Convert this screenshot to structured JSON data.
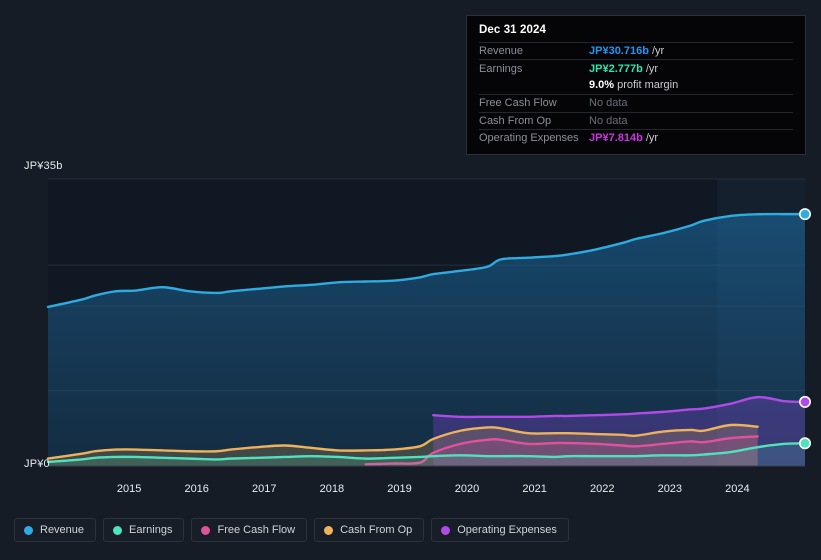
{
  "axes": {
    "y_top_label": "JP¥35b",
    "y_zero_label": "JP¥0",
    "x_ticks": [
      "2015",
      "2016",
      "2017",
      "2018",
      "2019",
      "2020",
      "2021",
      "2022",
      "2023",
      "2024"
    ]
  },
  "tooltip": {
    "date": "Dec 31 2024",
    "rows": [
      {
        "label": "Revenue",
        "value": "JP¥30.716b",
        "suffix": "/yr",
        "color": "#2196f3",
        "muted": false
      },
      {
        "label": "Earnings",
        "value": "JP¥2.777b",
        "suffix": "/yr",
        "color": "#2ee6b0",
        "muted": false
      },
      {
        "label": "",
        "value": "9.0%",
        "suffix": "profit margin",
        "color": "#ffffff",
        "muted": false
      },
      {
        "label": "Free Cash Flow",
        "value": "No data",
        "suffix": "",
        "color": "#6b6f77",
        "muted": true
      },
      {
        "label": "Cash From Op",
        "value": "No data",
        "suffix": "",
        "color": "#6b6f77",
        "muted": true
      },
      {
        "label": "Operating Expenses",
        "value": "JP¥7.814b",
        "suffix": "/yr",
        "color": "#c936e0",
        "muted": false
      }
    ]
  },
  "legend": [
    {
      "label": "Revenue",
      "color": "#2eabe0"
    },
    {
      "label": "Earnings",
      "color": "#4fe3bd"
    },
    {
      "label": "Free Cash Flow",
      "color": "#e0529c"
    },
    {
      "label": "Cash From Op",
      "color": "#eeb25a"
    },
    {
      "label": "Operating Expenses",
      "color": "#b04ae8"
    }
  ],
  "chart_data": {
    "type": "area",
    "title": "",
    "xlabel": "",
    "ylabel": "JP¥ (billions)",
    "ylim": [
      0,
      35
    ],
    "xlim": [
      2014.3,
      2025.5
    ],
    "grid": true,
    "currency": "JP¥",
    "units": "billions per year",
    "gridlines_y": [
      0,
      9.2,
      19.5,
      24.5,
      35
    ],
    "legend_position": "bottom-left",
    "forecast_region_start_x": 2024.2,
    "x": [
      2014.3,
      2014.8,
      2015.0,
      2015.3,
      2015.6,
      2016.0,
      2016.4,
      2016.8,
      2017.0,
      2017.4,
      2017.8,
      2018.2,
      2018.6,
      2019.0,
      2019.4,
      2019.8,
      2020.0,
      2020.4,
      2020.8,
      2021.0,
      2021.4,
      2021.8,
      2022.0,
      2022.4,
      2022.8,
      2023.0,
      2023.4,
      2023.8,
      2024.0,
      2024.4,
      2024.8,
      2025.2,
      2025.5
    ],
    "series": [
      {
        "name": "Revenue",
        "color": "#2eabe0",
        "fill": "rgba(33,122,184,0.30)",
        "end_value": 30.716,
        "end_label": "JP¥30.716b /yr",
        "values": [
          19.4,
          20.3,
          20.8,
          21.3,
          21.4,
          21.8,
          21.3,
          21.1,
          21.3,
          21.6,
          21.9,
          22.1,
          22.4,
          22.5,
          22.6,
          23.0,
          23.4,
          23.8,
          24.3,
          25.2,
          25.4,
          25.6,
          25.8,
          26.4,
          27.2,
          27.7,
          28.4,
          29.3,
          29.9,
          30.5,
          30.7,
          30.716,
          30.716
        ]
      },
      {
        "name": "Earnings",
        "color": "#4fe3bd",
        "fill": "rgba(79,227,189,0.16)",
        "end_value": 2.777,
        "end_label": "JP¥2.777b /yr",
        "values": [
          0.5,
          0.8,
          1.0,
          1.1,
          1.1,
          1.0,
          0.9,
          0.8,
          0.9,
          1.0,
          1.1,
          1.2,
          1.1,
          0.9,
          1.0,
          1.1,
          1.2,
          1.3,
          1.2,
          1.2,
          1.2,
          1.1,
          1.2,
          1.2,
          1.2,
          1.2,
          1.3,
          1.3,
          1.4,
          1.7,
          2.3,
          2.7,
          2.777
        ]
      },
      {
        "name": "Free Cash Flow",
        "color": "#e0529c",
        "fill": "rgba(224,82,156,0.18)",
        "end_value": null,
        "end_label": "No data",
        "starts_at_x": 2019.0,
        "ends_at_x": 2024.9,
        "values": [
          null,
          null,
          null,
          null,
          null,
          null,
          null,
          null,
          null,
          null,
          null,
          null,
          null,
          0.2,
          0.3,
          0.4,
          1.6,
          2.7,
          3.2,
          3.2,
          2.7,
          2.8,
          2.8,
          2.7,
          2.5,
          2.4,
          2.7,
          3.0,
          2.9,
          3.4,
          3.6,
          null,
          null
        ]
      },
      {
        "name": "Cash From Op",
        "color": "#eeb25a",
        "fill": "rgba(238,178,90,0.20)",
        "end_value": null,
        "end_label": "No data",
        "ends_at_x": 2024.9,
        "values": [
          0.9,
          1.5,
          1.8,
          2.0,
          2.0,
          1.9,
          1.8,
          1.8,
          2.0,
          2.3,
          2.5,
          2.2,
          1.9,
          1.9,
          2.0,
          2.4,
          3.3,
          4.3,
          4.7,
          4.6,
          4.0,
          4.0,
          4.0,
          3.9,
          3.8,
          3.7,
          4.2,
          4.4,
          4.3,
          5.0,
          4.8,
          null,
          null
        ]
      },
      {
        "name": "Operating Expenses",
        "color": "#b04ae8",
        "fill": "rgba(140,70,220,0.30)",
        "end_value": 7.814,
        "end_label": "JP¥7.814b /yr",
        "starts_at_x": 2019.9,
        "values": [
          null,
          null,
          null,
          null,
          null,
          null,
          null,
          null,
          null,
          null,
          null,
          null,
          null,
          null,
          null,
          null,
          6.2,
          6.0,
          6.0,
          6.0,
          6.0,
          6.1,
          6.1,
          6.2,
          6.3,
          6.4,
          6.6,
          6.9,
          7.0,
          7.6,
          8.4,
          7.9,
          7.814
        ]
      }
    ]
  }
}
